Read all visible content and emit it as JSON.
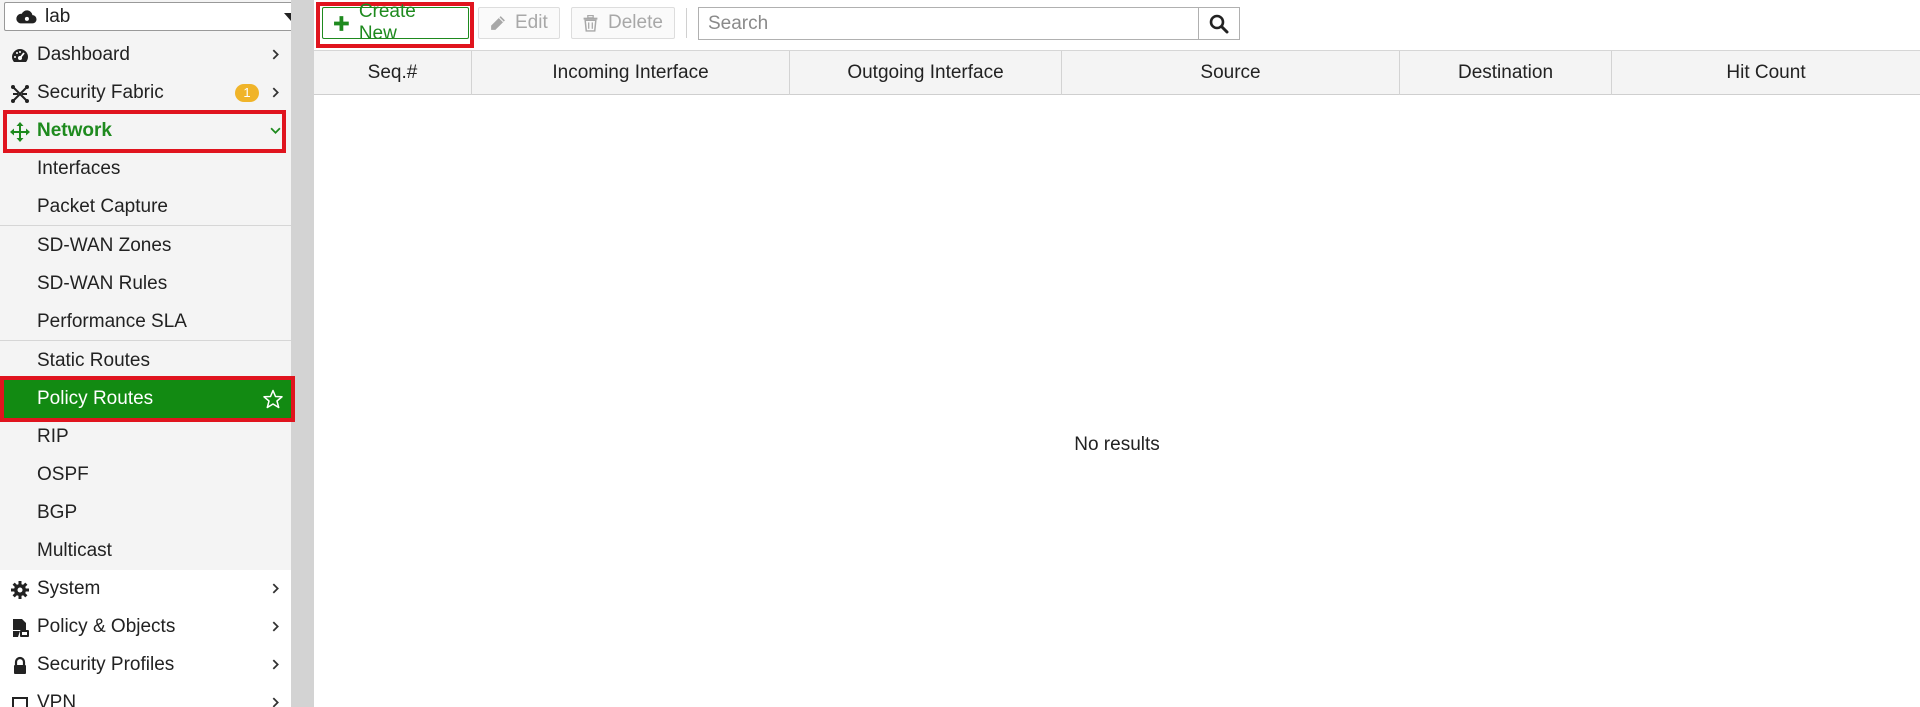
{
  "vdom": {
    "label": "lab"
  },
  "sidebar": {
    "top_items": [
      {
        "label": "Dashboard"
      },
      {
        "label": "Security Fabric",
        "badge": "1"
      },
      {
        "label": "Network"
      }
    ],
    "network_sub": [
      {
        "label": "Interfaces"
      },
      {
        "label": "Packet Capture"
      },
      {
        "label": "SD-WAN Zones"
      },
      {
        "label": "SD-WAN Rules"
      },
      {
        "label": "Performance SLA"
      },
      {
        "label": "Static Routes"
      },
      {
        "label": "Policy Routes"
      },
      {
        "label": "RIP"
      },
      {
        "label": "OSPF"
      },
      {
        "label": "BGP"
      },
      {
        "label": "Multicast"
      }
    ],
    "bottom_items": [
      {
        "label": "System"
      },
      {
        "label": "Policy & Objects"
      },
      {
        "label": "Security Profiles"
      },
      {
        "label": "VPN"
      }
    ]
  },
  "toolbar": {
    "create_label": "Create New",
    "edit_label": "Edit",
    "delete_label": "Delete",
    "search_placeholder": "Search"
  },
  "table": {
    "columns": [
      "Seq.#",
      "Incoming Interface",
      "Outgoing Interface",
      "Source",
      "Destination",
      "Hit Count"
    ],
    "empty_text": "No results"
  },
  "colors": {
    "accent_green": "#128a12",
    "highlight_red": "#e0141e",
    "badge_orange": "#f0b429"
  }
}
